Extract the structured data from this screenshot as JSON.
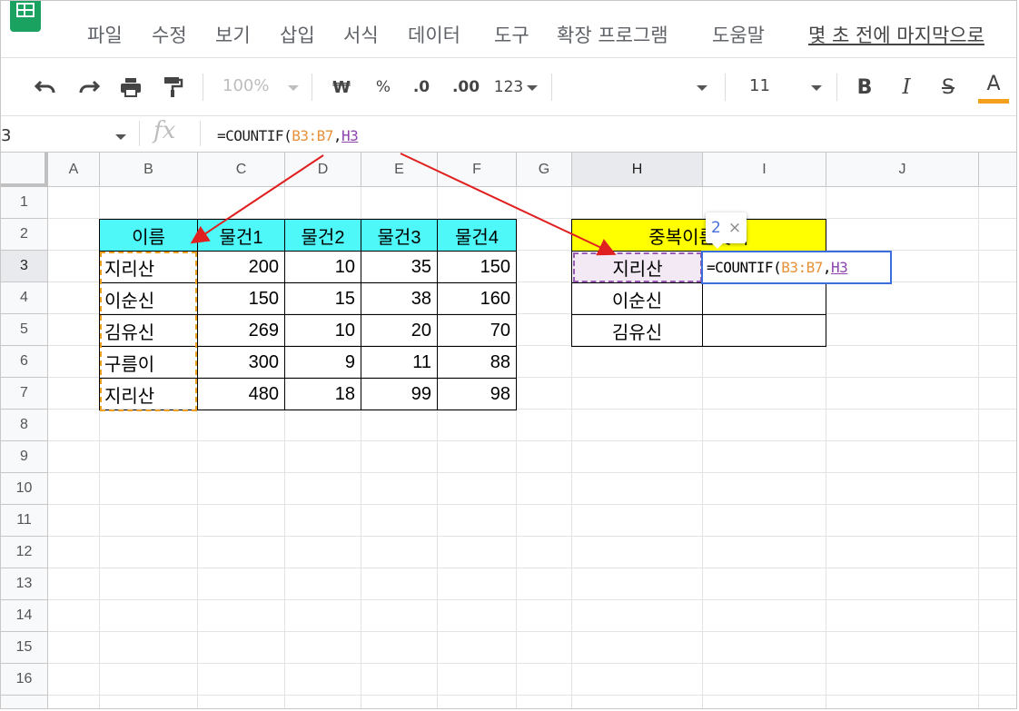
{
  "menu": {
    "items": [
      "파일",
      "수정",
      "보기",
      "삽입",
      "서식",
      "데이터",
      "도구",
      "확장 프로그램",
      "도움말"
    ],
    "last_edit": "몇 초 전에 마지막으로"
  },
  "toolbar": {
    "zoom": "100%",
    "currency": "₩",
    "percent": "%",
    "decrease_decimal": ".0",
    "increase_decimal": ".00",
    "number_format": "123",
    "font_size": "11",
    "bold": "B",
    "italic": "I",
    "strike": "S",
    "text_color": "A",
    "text_color_hex": "#f4a01d"
  },
  "formula_bar": {
    "namebox": "3",
    "fx": "fx",
    "formula_prefix": "=COUNTIF(",
    "ref1": "B3:B7",
    "comma": ",",
    "ref2": "H3"
  },
  "grid": {
    "columns": [
      "A",
      "B",
      "C",
      "D",
      "E",
      "F",
      "G",
      "H",
      "I",
      "J"
    ],
    "rows": [
      "1",
      "2",
      "3",
      "4",
      "5",
      "6",
      "7",
      "8",
      "9",
      "10",
      "11",
      "12",
      "13",
      "14",
      "15",
      "16"
    ]
  },
  "table1": {
    "headers": [
      "이름",
      "물건1",
      "물건2",
      "물건3",
      "물건4"
    ],
    "rows": [
      [
        "지리산",
        "200",
        "10",
        "35",
        "150"
      ],
      [
        "이순신",
        "150",
        "15",
        "38",
        "160"
      ],
      [
        "김유신",
        "269",
        "10",
        "20",
        "70"
      ],
      [
        "구름이",
        "300",
        "9",
        "11",
        "88"
      ],
      [
        "지리산",
        "480",
        "18",
        "99",
        "98"
      ]
    ]
  },
  "table2": {
    "header": "중복이름찾기",
    "names": [
      "지리산",
      "이순신",
      "김유신"
    ],
    "edit_prefix": "=COUNTIF(",
    "edit_ref1": "B3:B7",
    "edit_comma": ",",
    "edit_ref2": "H3"
  },
  "tooltip": {
    "value": "2",
    "close": "×"
  },
  "colors": {
    "cyan_header": "#4ef8f8",
    "yellow_header": "#ffff00",
    "range_orange": "#e69138",
    "ref_purple": "#8e44ad",
    "arrow_red": "#e02020",
    "edit_blue": "#3b6ddc"
  }
}
